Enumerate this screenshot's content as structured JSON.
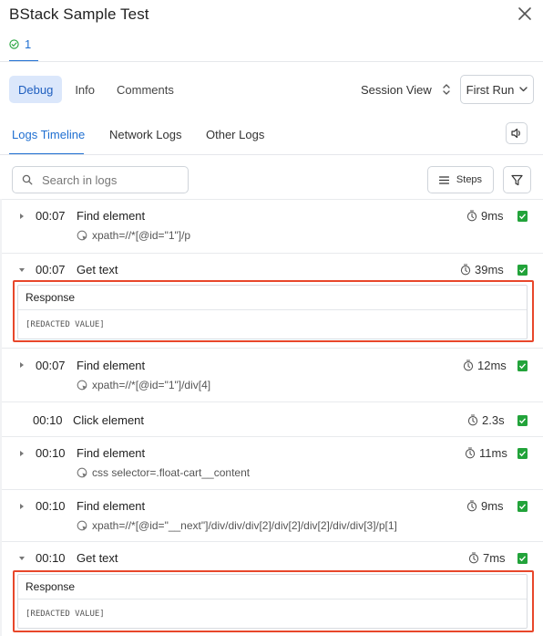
{
  "window": {
    "title": "BStack Sample Test"
  },
  "status": {
    "passed_count": "1"
  },
  "top_tabs": [
    {
      "label": "Debug",
      "active": true
    },
    {
      "label": "Info",
      "active": false
    },
    {
      "label": "Comments",
      "active": false
    }
  ],
  "session_view": {
    "label": "Session View"
  },
  "run_select": {
    "value": "First Run"
  },
  "log_tabs": [
    {
      "label": "Logs Timeline",
      "active": true
    },
    {
      "label": "Network Logs",
      "active": false
    },
    {
      "label": "Other Logs",
      "active": false
    }
  ],
  "search": {
    "placeholder": "Search in logs"
  },
  "steps_button": {
    "label": "Steps"
  },
  "colors": {
    "accent": "#1f6fd1",
    "highlight": "#e8472b",
    "log_icon": "#22a33a",
    "passed": "#22a33a"
  },
  "logs": [
    {
      "time": "00:07",
      "action": "Find element",
      "duration": "9ms",
      "expanded": false,
      "locator": "xpath=//*[@id=\"1\"]/p"
    },
    {
      "time": "00:07",
      "action": "Get text",
      "duration": "39ms",
      "expanded": true,
      "response_label": "Response",
      "response_value": "[REDACTED VALUE]"
    },
    {
      "time": "00:07",
      "action": "Find element",
      "duration": "12ms",
      "expanded": false,
      "locator": "xpath=//*[@id=\"1\"]/div[4]"
    },
    {
      "time": "00:10",
      "action": "Click element",
      "duration": "2.3s",
      "expanded": false
    },
    {
      "time": "00:10",
      "action": "Find element",
      "duration": "11ms",
      "expanded": false,
      "locator": "css selector=.float-cart__content"
    },
    {
      "time": "00:10",
      "action": "Find element",
      "duration": "9ms",
      "expanded": false,
      "locator": "xpath=//*[@id=\"__next\"]/div/div/div[2]/div[2]/div[2]/div/div[3]/p[1]"
    },
    {
      "time": "00:10",
      "action": "Get text",
      "duration": "7ms",
      "expanded": true,
      "response_label": "Response",
      "response_value": "[REDACTED VALUE]"
    }
  ]
}
